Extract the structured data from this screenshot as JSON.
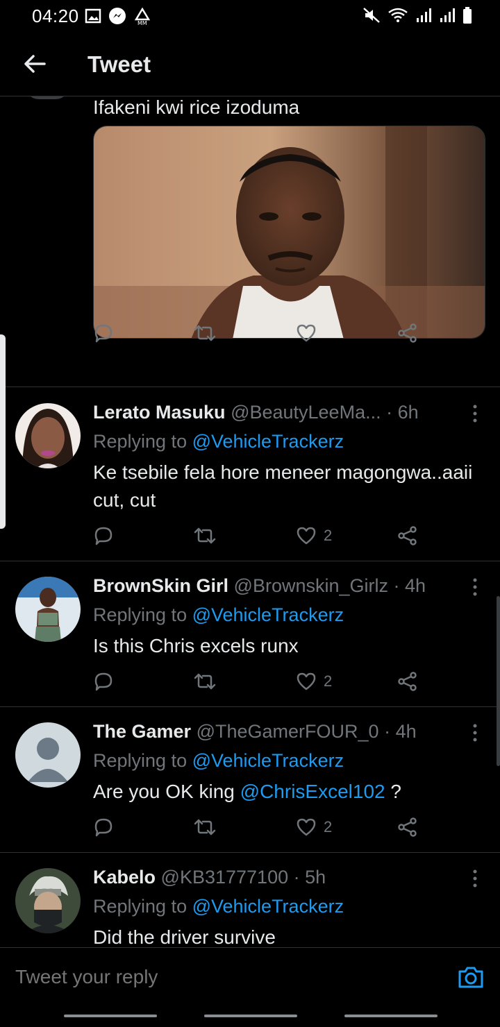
{
  "status_bar": {
    "time": "04:20"
  },
  "header": {
    "title": "Tweet"
  },
  "top_tweet": {
    "text": "Ifakeni kwi rice izoduma"
  },
  "replies": [
    {
      "name": "Lerato Masuku",
      "handle": "@BeautyLeeMa...",
      "dot": " · ",
      "time": "6h",
      "replying_prefix": "Replying to ",
      "replying_to": "@VehicleTrackerz",
      "text": "Ke tsebile fela hore meneer magongwa..aaii cut, cut",
      "likes": "2"
    },
    {
      "name": "BrownSkin Girl",
      "handle": "@Brownskin_Girlz",
      "dot": " · ",
      "time": "4h",
      "replying_prefix": "Replying to ",
      "replying_to": "@VehicleTrackerz",
      "text": "Is this Chris excels runx",
      "likes": "2"
    },
    {
      "name": "The Gamer",
      "handle": "@TheGamerFOUR_0",
      "dot": " · ",
      "time": "4h",
      "replying_prefix": "Replying to ",
      "replying_to": "@VehicleTrackerz",
      "text_before": "Are you OK king ",
      "text_mention": "@ChrisExcel102",
      "text_after": " ?",
      "likes": "2"
    },
    {
      "name": "Kabelo",
      "handle": "@KB31777100",
      "dot": " · ",
      "time": "5h",
      "replying_prefix": "Replying to ",
      "replying_to": "@VehicleTrackerz",
      "text": "Did the driver survive"
    }
  ],
  "compose": {
    "placeholder": "Tweet your reply"
  },
  "colors": {
    "background": "#000000",
    "accent": "#1d9bf0",
    "muted": "#71767b",
    "divider": "#2f3336"
  },
  "icons": [
    "back-arrow-icon",
    "reply-icon",
    "retweet-icon",
    "like-icon",
    "share-icon",
    "more-icon",
    "camera-icon"
  ]
}
